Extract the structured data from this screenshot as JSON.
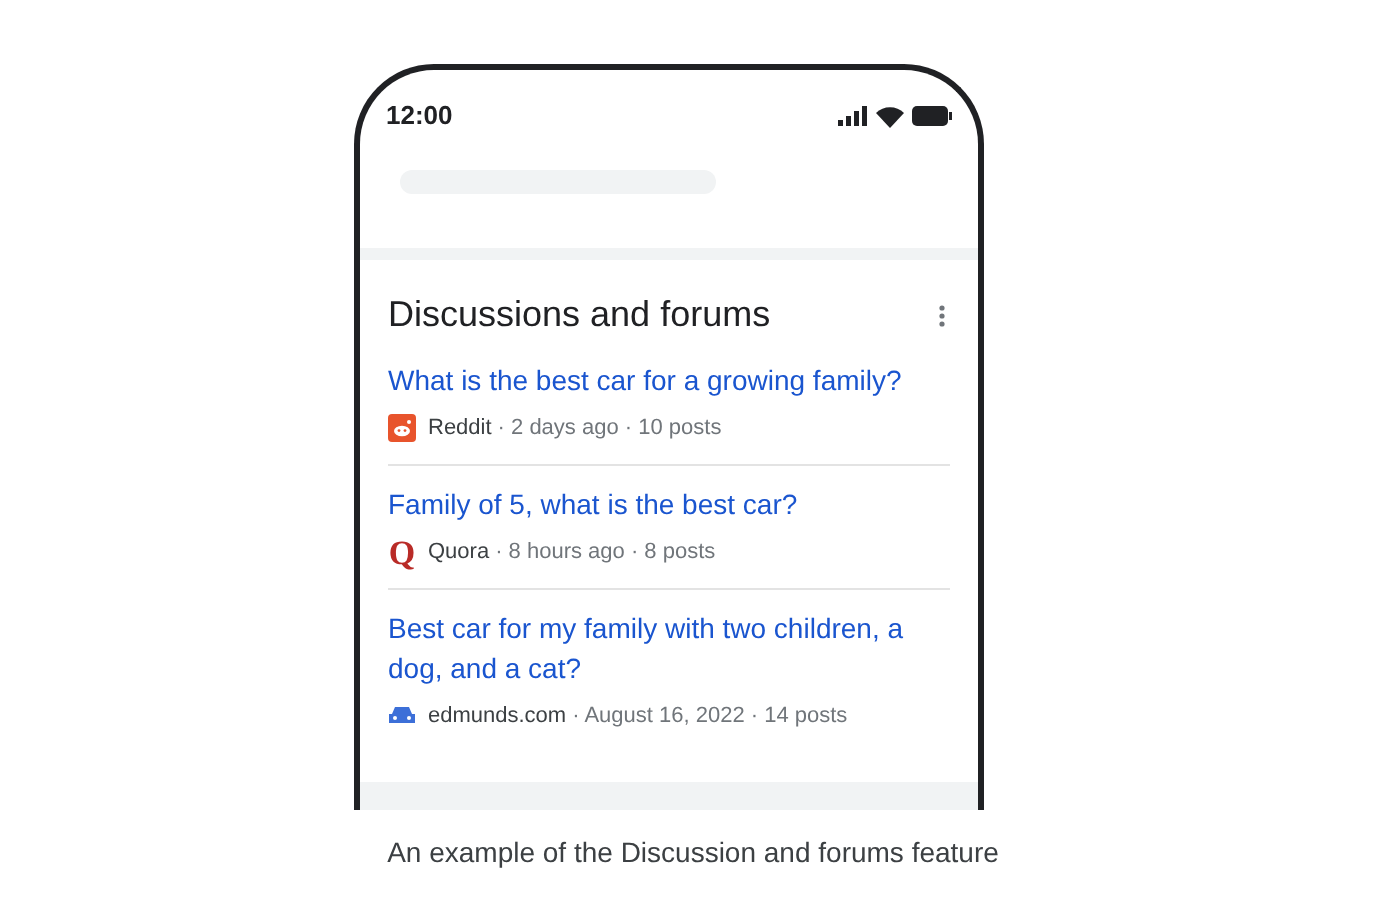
{
  "status_bar": {
    "time": "12:00"
  },
  "card": {
    "title": "Discussions and forums",
    "results": [
      {
        "title": "What is the best car for a growing family?",
        "kind": "reddit",
        "source": "Reddit",
        "meta": "· 2 days ago · 10 posts"
      },
      {
        "title": "Family of 5, what is the best car?",
        "kind": "quora",
        "logo_text": "Q",
        "source": "Quora",
        "meta": "· 8 hours ago · 8 posts"
      },
      {
        "title": "Best car for my family with two children, a dog, and a cat?",
        "kind": "edmunds",
        "source": "edmunds.com",
        "meta": "· August 16, 2022 · 14 posts"
      }
    ]
  },
  "caption": "An example of the Discussion and forums feature"
}
